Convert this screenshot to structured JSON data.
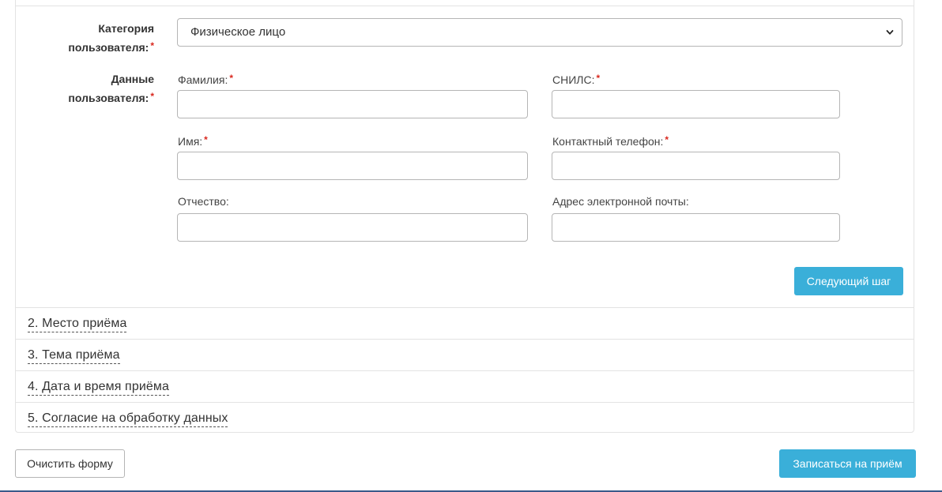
{
  "form": {
    "category": {
      "label": "Категория пользователя:",
      "label_line1": "Категория",
      "label_line2": "пользователя:",
      "required_mark": "*",
      "selected_value": "Физическое лицо"
    },
    "user_data": {
      "label_line1": "Данные",
      "label_line2": "пользователя:",
      "required_mark": "*",
      "fields": {
        "last_name": {
          "label": "Фамилия:",
          "required": "*",
          "value": ""
        },
        "first_name": {
          "label": "Имя:",
          "required": "*",
          "value": ""
        },
        "patronymic": {
          "label": "Отчество:",
          "value": ""
        },
        "snils": {
          "label": "СНИЛС:",
          "required": "*",
          "value": ""
        },
        "phone": {
          "label": "Контактный телефон:",
          "required": "*",
          "value": ""
        },
        "email": {
          "label": "Адрес электронной почты:",
          "value": ""
        }
      }
    },
    "next_step_label": "Следующий шаг",
    "steps": [
      {
        "label": "2. Место приёма"
      },
      {
        "label": "3. Тема приёма"
      },
      {
        "label": "4. Дата и время приёма"
      },
      {
        "label": "5. Согласие на обработку данных"
      }
    ],
    "clear_label": "Очистить форму",
    "submit_label": "Записаться на приём"
  },
  "colors": {
    "primary_button": "#3aafd9",
    "required_mark": "#d9281e",
    "border": "#b5b5b5"
  }
}
